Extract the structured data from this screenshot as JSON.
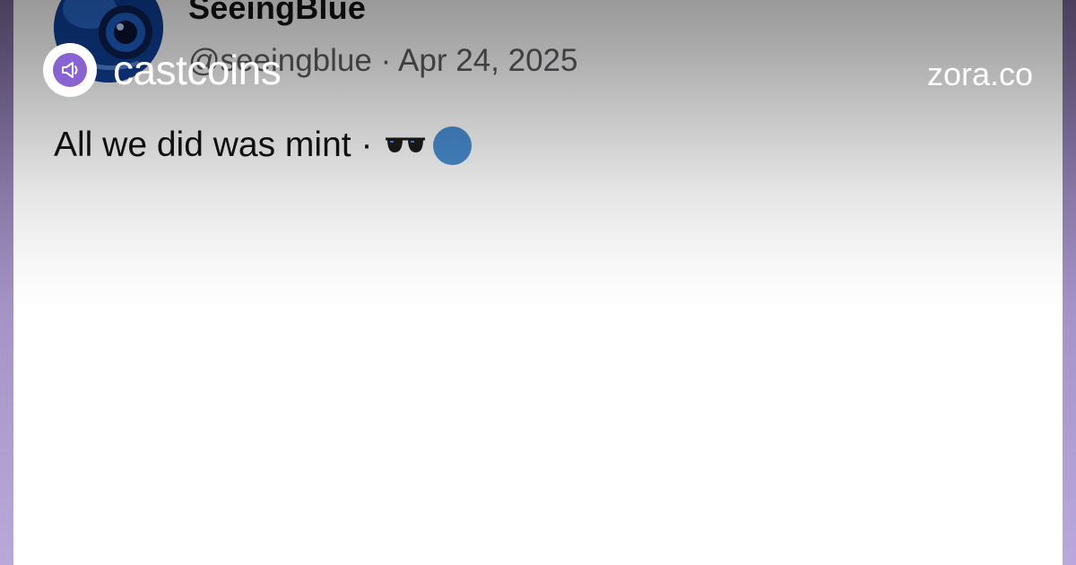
{
  "post": {
    "display_name": "SeeingBlue",
    "handle": "@seeingblue",
    "separator": "·",
    "date": "Apr 24, 2025",
    "text": "All we did was mint ·",
    "emoji": [
      "sunglasses-icon",
      "blue-circle-icon"
    ]
  },
  "overlay": {
    "brand_name": "castcoins",
    "brand_icon": "megaphone-icon",
    "site_name": "zora.co"
  },
  "colors": {
    "frame": "#b5a4d6",
    "brand_purple": "#8a63d2",
    "blue_circle": "#4a90d4"
  }
}
